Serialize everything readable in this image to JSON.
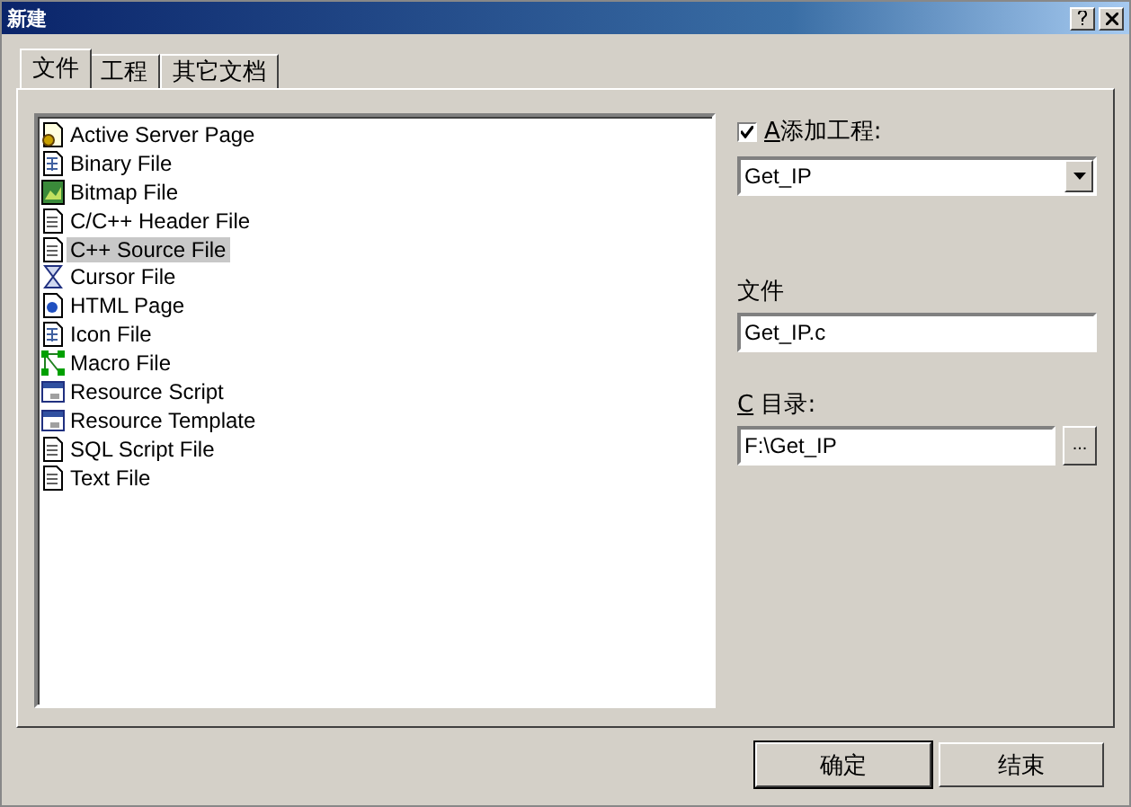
{
  "window": {
    "title": "新建"
  },
  "tabs": [
    {
      "label": "文件",
      "selected": true
    },
    {
      "label": "工程",
      "selected": false
    },
    {
      "label": "其它文档",
      "selected": false
    }
  ],
  "file_types": [
    {
      "label": "Active Server Page",
      "kind": "gear",
      "selected": false
    },
    {
      "label": "Binary File",
      "kind": "grid",
      "selected": false
    },
    {
      "label": "Bitmap File",
      "kind": "image",
      "selected": false
    },
    {
      "label": "C/C++ Header File",
      "kind": "document",
      "selected": false
    },
    {
      "label": "C++ Source File",
      "kind": "document",
      "selected": true
    },
    {
      "label": "Cursor File",
      "kind": "hourglass",
      "selected": false
    },
    {
      "label": "HTML Page",
      "kind": "globe",
      "selected": false
    },
    {
      "label": "Icon File",
      "kind": "grid",
      "selected": false
    },
    {
      "label": "Macro File",
      "kind": "nodes",
      "selected": false
    },
    {
      "label": "Resource Script",
      "kind": "window",
      "selected": false
    },
    {
      "label": "Resource Template",
      "kind": "window",
      "selected": false
    },
    {
      "label": "SQL Script File",
      "kind": "document",
      "selected": false
    },
    {
      "label": "Text File",
      "kind": "document",
      "selected": false
    }
  ],
  "add_to_project": {
    "accelerator": "A",
    "label": "添加工程:",
    "checked": true,
    "value": "Get_IP"
  },
  "file_name": {
    "label": "文件",
    "value": "Get_IP.c"
  },
  "directory": {
    "accelerator": "C",
    "label": " 目录:",
    "value": "F:\\Get_IP",
    "browse": "..."
  },
  "buttons": [
    {
      "label": "确定",
      "default": true
    },
    {
      "label": "结束",
      "default": false
    }
  ]
}
